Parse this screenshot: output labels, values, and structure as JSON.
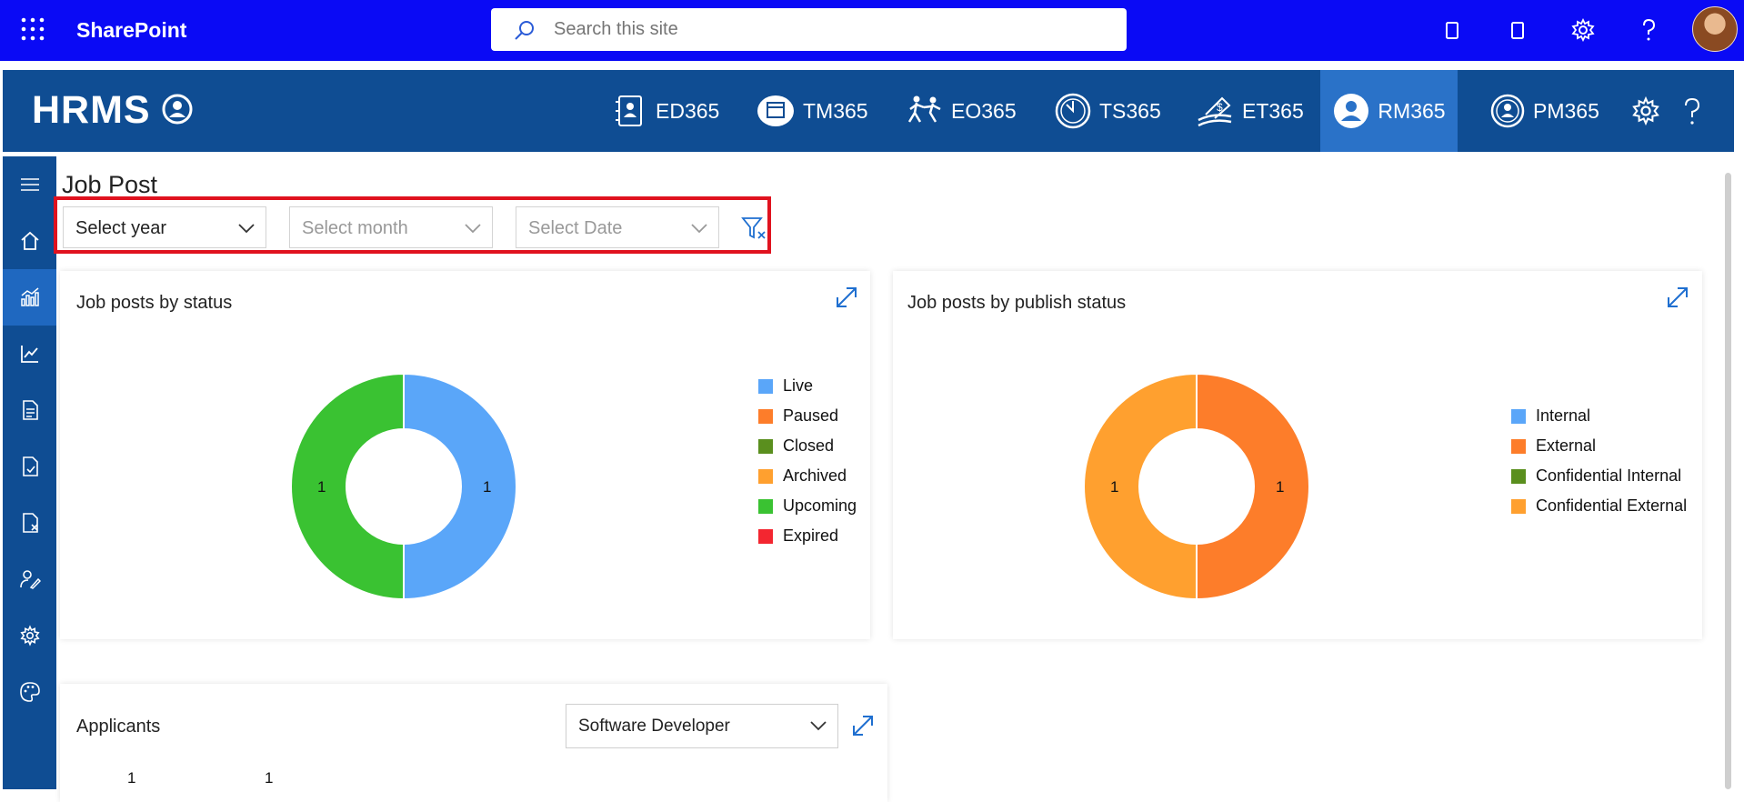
{
  "sharepoint": {
    "title": "SharePoint",
    "search_placeholder": "Search this site"
  },
  "hrms": {
    "logo": "HRMS",
    "nav": [
      {
        "label": "ED365",
        "icon": "employee-directory-icon"
      },
      {
        "label": "TM365",
        "icon": "calendar-icon"
      },
      {
        "label": "EO365",
        "icon": "onboarding-icon"
      },
      {
        "label": "TS365",
        "icon": "clock-icon"
      },
      {
        "label": "ET365",
        "icon": "expense-icon"
      },
      {
        "label": "RM365",
        "icon": "recruitment-icon",
        "active": true
      },
      {
        "label": "PM365",
        "icon": "performance-icon"
      }
    ]
  },
  "page": {
    "title": "Job Post"
  },
  "filters": {
    "year": "Select year",
    "month": "Select month",
    "date": "Select Date"
  },
  "cards": {
    "status": {
      "title": "Job posts by status",
      "legend": [
        "Live",
        "Paused",
        "Closed",
        "Archived",
        "Upcoming",
        "Expired"
      ],
      "labels": [
        "1",
        "1"
      ]
    },
    "publish": {
      "title": "Job posts by publish status",
      "legend": [
        "Internal",
        "External",
        "Confidential Internal",
        "Confidential External"
      ],
      "labels": [
        "1",
        "1"
      ]
    },
    "applicants": {
      "title": "Applicants",
      "select_value": "Software Developer",
      "values": [
        "1",
        "1"
      ]
    }
  },
  "colors": {
    "live": "#5aa6f9",
    "paused": "#fd7d2a",
    "closed": "#5a8f1e",
    "archived": "#ffa02f",
    "upcoming": "#3ac232",
    "expired": "#f32630",
    "internal": "#5aa6f9",
    "external": "#fd7d2a",
    "confidential_internal": "#5a8f1e",
    "confidential_external": "#ffa02f"
  },
  "chart_data": [
    {
      "type": "pie",
      "title": "Job posts by status",
      "categories": [
        "Live",
        "Paused",
        "Closed",
        "Archived",
        "Upcoming",
        "Expired"
      ],
      "values": [
        1,
        0,
        0,
        0,
        1,
        0
      ],
      "legend_position": "right"
    },
    {
      "type": "pie",
      "title": "Job posts by publish status",
      "categories": [
        "Internal",
        "External",
        "Confidential Internal",
        "Confidential External"
      ],
      "values": [
        0,
        1,
        0,
        1
      ],
      "legend_position": "right"
    }
  ]
}
